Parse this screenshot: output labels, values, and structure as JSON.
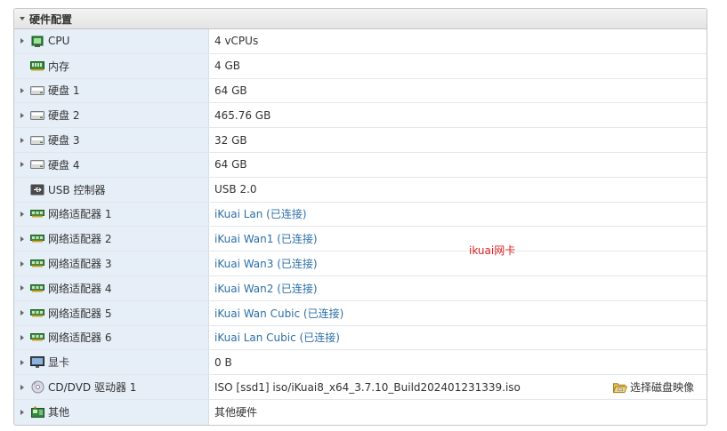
{
  "panel": {
    "title": "硬件配置"
  },
  "rows": [
    {
      "label": "CPU",
      "value": "4 vCPUs",
      "icon": "cpu-icon",
      "expandable": true,
      "link": false
    },
    {
      "label": "内存",
      "value": "4 GB",
      "icon": "memory-icon",
      "expandable": false,
      "link": false
    },
    {
      "label": "硬盘 1",
      "value": "64 GB",
      "icon": "hard-disk-icon",
      "expandable": true,
      "link": false
    },
    {
      "label": "硬盘 2",
      "value": "465.76 GB",
      "icon": "hard-disk-icon",
      "expandable": true,
      "link": false
    },
    {
      "label": "硬盘 3",
      "value": "32 GB",
      "icon": "hard-disk-icon",
      "expandable": true,
      "link": false
    },
    {
      "label": "硬盘 4",
      "value": "64 GB",
      "icon": "hard-disk-icon",
      "expandable": true,
      "link": false
    },
    {
      "label": "USB 控制器",
      "value": "USB 2.0",
      "icon": "usb-icon",
      "expandable": false,
      "link": false
    },
    {
      "label": "网络适配器 1",
      "value": "iKuai Lan (已连接)",
      "icon": "network-adapter-icon",
      "expandable": true,
      "link": true
    },
    {
      "label": "网络适配器 2",
      "value": "iKuai Wan1 (已连接)",
      "icon": "network-adapter-icon",
      "expandable": true,
      "link": true
    },
    {
      "label": "网络适配器 3",
      "value": "iKuai Wan3 (已连接)",
      "icon": "network-adapter-icon",
      "expandable": true,
      "link": true
    },
    {
      "label": "网络适配器 4",
      "value": "iKuai Wan2 (已连接)",
      "icon": "network-adapter-icon",
      "expandable": true,
      "link": true
    },
    {
      "label": "网络适配器 5",
      "value": "iKuai Wan Cubic (已连接)",
      "icon": "network-adapter-icon",
      "expandable": true,
      "link": true
    },
    {
      "label": "网络适配器 6",
      "value": "iKuai Lan Cubic (已连接)",
      "icon": "network-adapter-icon",
      "expandable": true,
      "link": true
    },
    {
      "label": "显卡",
      "value": "0 B",
      "icon": "display-icon",
      "expandable": true,
      "link": false
    },
    {
      "label": "CD/DVD 驱动器 1",
      "value": "ISO [ssd1] iso/iKuai8_x64_3.7.10_Build202401231339.iso",
      "icon": "cd-dvd-icon",
      "expandable": true,
      "link": false
    },
    {
      "label": "其他",
      "value": "其他硬件",
      "icon": "other-hardware-icon",
      "expandable": true,
      "link": false
    }
  ],
  "cd_action": {
    "label": "选择磁盘映像",
    "icon": "folder-open-icon"
  },
  "annotation": {
    "text": "ikuai网卡",
    "color": "#e02020"
  },
  "colors": {
    "label_bg": "#e6eef7",
    "link": "#2c6fa8",
    "header_bg": "#ebebeb"
  }
}
